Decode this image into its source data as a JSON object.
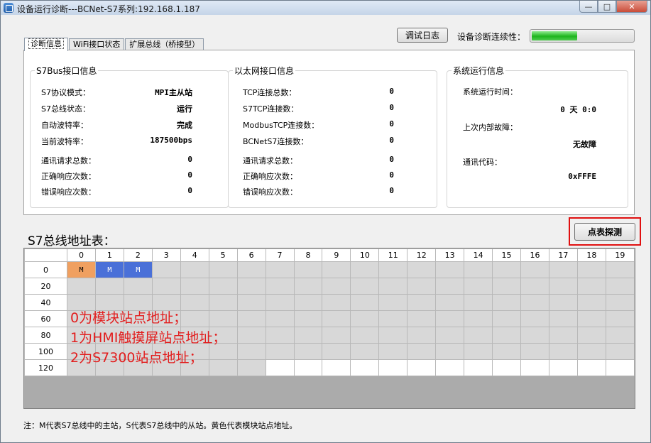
{
  "window": {
    "title": "设备运行诊断---BCNet-S7系列:192.168.1.187"
  },
  "tabs": [
    {
      "label": "诊断信息"
    },
    {
      "label": "WiFi接口状态"
    },
    {
      "label": "扩展总线（桥接型）"
    }
  ],
  "toolbar": {
    "log_button": "调试日志",
    "continuity_label": "设备诊断连续性：",
    "continuity_fraction": 0.45
  },
  "s7bus": {
    "title": "S7Bus接口信息",
    "rows": [
      {
        "label": "S7协议模式：",
        "value": "MPI主从站"
      },
      {
        "label": "S7总线状态：",
        "value": "运行"
      },
      {
        "label": "自动波特率：",
        "value": "完成"
      },
      {
        "label": "当前波特率：",
        "value": "187500bps"
      },
      {
        "label": "通讯请求总数：",
        "value": "0"
      },
      {
        "label": "正确响应次数：",
        "value": "0"
      },
      {
        "label": "错误响应次数：",
        "value": "0"
      }
    ]
  },
  "ethernet": {
    "title": "以太网接口信息",
    "rows": [
      {
        "label": "TCP连接总数：",
        "value": "0"
      },
      {
        "label": "S7TCP连接数：",
        "value": "0"
      },
      {
        "label": "ModbusTCP连接数：",
        "value": "0"
      },
      {
        "label": "BCNetS7连接数：",
        "value": "0"
      },
      {
        "label": "通讯请求总数：",
        "value": "0"
      },
      {
        "label": "正确响应次数：",
        "value": "0"
      },
      {
        "label": "错误响应次数：",
        "value": "0"
      }
    ]
  },
  "system": {
    "title": "系统运行信息",
    "runtime_label": "系统运行时间：",
    "runtime_value": "0 天 0:0",
    "fault_label": "上次内部故障：",
    "fault_value": "无故障",
    "code_label": "通讯代码：",
    "code_value": "0xFFFE"
  },
  "address_table": {
    "title": "S7总线地址表：",
    "probe_button": "点表探测",
    "columns": [
      "0",
      "1",
      "2",
      "3",
      "4",
      "5",
      "6",
      "7",
      "8",
      "9",
      "10",
      "11",
      "12",
      "13",
      "14",
      "15",
      "16",
      "17",
      "18",
      "19"
    ],
    "rows": [
      "0",
      "20",
      "40",
      "60",
      "80",
      "100",
      "120"
    ],
    "occupied": [
      {
        "row": 0,
        "col": 0,
        "text": "M",
        "kind": "master"
      },
      {
        "row": 0,
        "col": 1,
        "text": "M",
        "kind": "slave"
      },
      {
        "row": 0,
        "col": 2,
        "text": "M",
        "kind": "slave"
      }
    ],
    "valid_last_row_cols": 7
  },
  "annotations": [
    "0为模块站点地址；",
    "1为HMI触摸屏站点地址；",
    "2为S7300站点地址；"
  ],
  "colors": {
    "master": "#f0a060",
    "slave": "#4a70d8",
    "annotation": "#e21d1d",
    "highlight_border": "#e01010"
  },
  "footnote": "注：M代表S7总线中的主站，S代表S7总线中的从站。黄色代表模块站点地址。"
}
